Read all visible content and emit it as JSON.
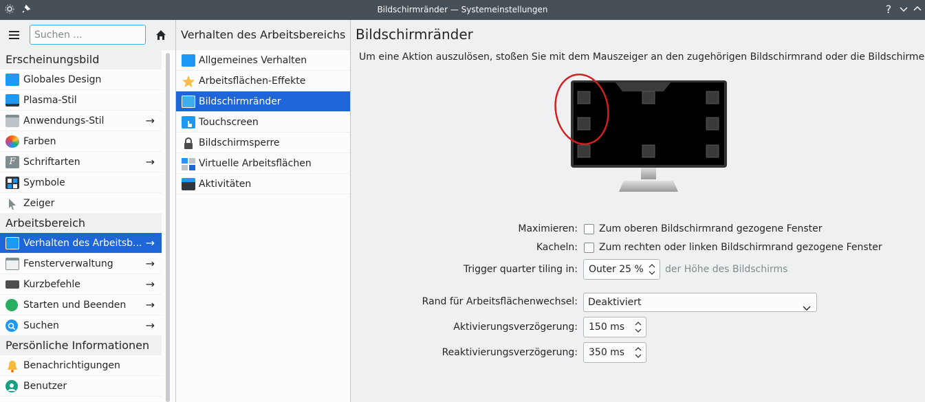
{
  "window": {
    "title": "Bildschirmränder — Systemeinstellungen",
    "help_glyph": "?"
  },
  "sidebar": {
    "search_placeholder": "Suchen ...",
    "groups": [
      {
        "label": "Erscheinungsbild",
        "items": [
          {
            "label": "Globales Design",
            "arrow": ""
          },
          {
            "label": "Plasma-Stil",
            "arrow": ""
          },
          {
            "label": "Anwendungs-Stil",
            "arrow": "→"
          },
          {
            "label": "Farben",
            "arrow": ""
          },
          {
            "label": "Schriftarten",
            "arrow": "→"
          },
          {
            "label": "Symbole",
            "arrow": ""
          },
          {
            "label": "Zeiger",
            "arrow": ""
          }
        ]
      },
      {
        "label": "Arbeitsbereich",
        "items": [
          {
            "label": "Verhalten des Arbeitsb...",
            "arrow": "→"
          },
          {
            "label": "Fensterverwaltung",
            "arrow": "→"
          },
          {
            "label": "Kurzbefehle",
            "arrow": "→"
          },
          {
            "label": "Starten und Beenden",
            "arrow": "→"
          },
          {
            "label": "Suchen",
            "arrow": "→"
          }
        ]
      },
      {
        "label": "Persönliche Informationen",
        "items": [
          {
            "label": "Benachrichtigungen",
            "arrow": ""
          },
          {
            "label": "Benutzer",
            "arrow": ""
          }
        ]
      }
    ]
  },
  "midpanel": {
    "title": "Verhalten des Arbeitsbereichs",
    "items": [
      {
        "label": "Allgemeines Verhalten"
      },
      {
        "label": "Arbeitsflächen-Effekte"
      },
      {
        "label": "Bildschirmränder"
      },
      {
        "label": "Touchscreen"
      },
      {
        "label": "Bildschirmsperre"
      },
      {
        "label": "Virtuelle Arbeitsflächen"
      },
      {
        "label": "Aktivitäten"
      }
    ]
  },
  "main": {
    "title": "Bildschirmränder",
    "description": "Um eine Aktion auszulösen, stoßen Sie mit dem Mauszeiger an den zugehörigen Bildschirmrand oder die Bildschirmecke",
    "maximize": {
      "label": "Maximieren:",
      "checkbox_label": "Zum oberen Bildschirmrand gezogene Fenster"
    },
    "tile": {
      "label": "Kacheln:",
      "checkbox_label": "Zum rechten oder linken Bildschirmrand gezogene Fenster"
    },
    "quarter": {
      "label": "Trigger quarter tiling in:",
      "value": "Outer 25 %",
      "suffix": "der Höhe des Bildschirms"
    },
    "desktop_switch": {
      "label": "Rand für Arbeitsflächenwechsel:",
      "value": "Deaktiviert"
    },
    "activation_delay": {
      "label": "Aktivierungsverzögerung:",
      "value": "150 ms"
    },
    "reactivation_delay": {
      "label": "Reaktivierungsverzögerung:",
      "value": "350 ms"
    }
  },
  "colors": {
    "accent": "#1e66d8",
    "highlight_ring": "#d31f1f"
  }
}
